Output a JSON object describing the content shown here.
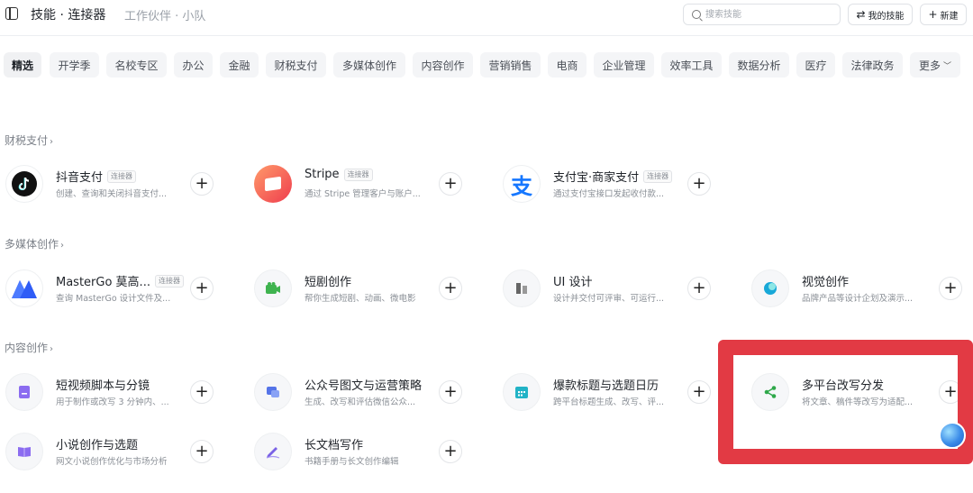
{
  "header": {
    "title": "技能 · 连接器",
    "subtitle": "工作伙伴 · 小队",
    "search_placeholder": "搜索技能",
    "my_skills_label": "我的技能",
    "new_label": "新建"
  },
  "tabs": [
    {
      "label": "精选"
    },
    {
      "label": "开学季"
    },
    {
      "label": "名校专区"
    },
    {
      "label": "办公"
    },
    {
      "label": "金融"
    },
    {
      "label": "财税支付"
    },
    {
      "label": "多媒体创作"
    },
    {
      "label": "内容创作"
    },
    {
      "label": "营销销售"
    },
    {
      "label": "电商"
    },
    {
      "label": "企业管理"
    },
    {
      "label": "效率工具"
    },
    {
      "label": "数据分析"
    },
    {
      "label": "医疗"
    },
    {
      "label": "法律政务"
    },
    {
      "label": "更多"
    }
  ],
  "sections": {
    "finance": {
      "title": "财税支付",
      "cards": [
        {
          "name": "抖音支付",
          "badge": "连接器",
          "desc": "创建、查询和关闭抖音支付...",
          "icon": "douyin-icon"
        },
        {
          "name": "Stripe",
          "badge": "连接器",
          "desc": "通过 Stripe 管理客户与账户...",
          "icon": "stripe-icon"
        },
        {
          "name": "支付宝·商家支付",
          "badge": "连接器",
          "desc": "通过支付宝接口发起收付款...",
          "icon": "alipay-icon"
        }
      ]
    },
    "media": {
      "title": "多媒体创作",
      "cards": [
        {
          "name": "MasterGo 莫高...",
          "badge": "连接器",
          "desc": "查询 MasterGo 设计文件及...",
          "icon": "mastergo-icon"
        },
        {
          "name": "短剧创作",
          "badge": "",
          "desc": "帮你生成短剧、动画、微电影",
          "icon": "camera-icon"
        },
        {
          "name": "UI 设计",
          "badge": "",
          "desc": "设计并交付可评审、可运行...",
          "icon": "ui-design-icon"
        },
        {
          "name": "视觉创作",
          "badge": "",
          "desc": "品牌产品等设计企划及演示...",
          "icon": "visual-icon"
        }
      ]
    },
    "content": {
      "title": "内容创作",
      "cards": [
        {
          "name": "短视频脚本与分镜",
          "badge": "",
          "desc": "用于制作或改写 3 分钟内、...",
          "icon": "script-icon"
        },
        {
          "name": "公众号图文与运营策略",
          "badge": "",
          "desc": "生成、改写和评估微信公众...",
          "icon": "article-icon"
        },
        {
          "name": "爆款标题与选题日历",
          "badge": "",
          "desc": "跨平台标题生成、改写、评...",
          "icon": "calendar-icon"
        },
        {
          "name": "多平台改写分发",
          "badge": "",
          "desc": "将文章、稿件等改写为适配...",
          "icon": "share-icon"
        },
        {
          "name": "小说创作与选题",
          "badge": "",
          "desc": "网文小说创作优化与市场分析",
          "icon": "book-icon"
        },
        {
          "name": "长文档写作",
          "badge": "",
          "desc": "书籍手册与长文创作编辑",
          "icon": "pen-icon"
        }
      ]
    }
  }
}
